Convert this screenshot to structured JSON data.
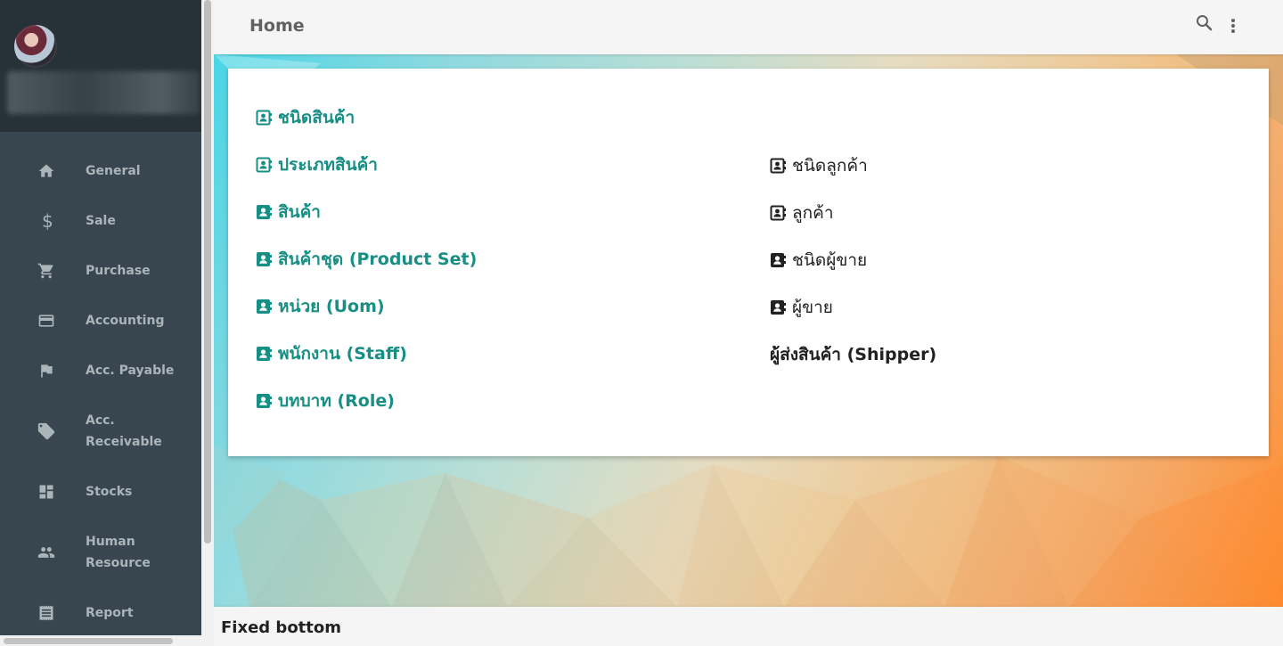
{
  "sidebar": {
    "items": [
      {
        "label": "General",
        "icon": "home-icon"
      },
      {
        "label": "Sale",
        "icon": "dollar-icon"
      },
      {
        "label": "Purchase",
        "icon": "cart-icon"
      },
      {
        "label": "Accounting",
        "icon": "credit-card-icon"
      },
      {
        "label": "Acc. Payable",
        "icon": "flag-icon"
      },
      {
        "label": "Acc.\nReceivable",
        "icon": "tag-icon"
      },
      {
        "label": "Stocks",
        "icon": "dashboard-icon"
      },
      {
        "label": "Human\nResource",
        "icon": "people-icon"
      },
      {
        "label": "Report",
        "icon": "receipt-icon"
      }
    ]
  },
  "header": {
    "title": "Home"
  },
  "main": {
    "left_links": [
      {
        "label": "ชนิดสินค้า",
        "icon": "contact-outline-icon"
      },
      {
        "label": "ประเภทสินค้า",
        "icon": "contact-outline-icon"
      },
      {
        "label": "สินค้า",
        "icon": "contact-filled-icon"
      },
      {
        "label": "สินค้าชุด (Product Set)",
        "icon": "contact-filled-icon"
      },
      {
        "label": "หน่วย (Uom)",
        "icon": "contact-filled-icon"
      },
      {
        "label": "พนักงาน (Staff)",
        "icon": "contact-filled-icon"
      },
      {
        "label": "บทบาท (Role)",
        "icon": "contact-filled-icon"
      }
    ],
    "right_links": [
      {
        "label": "ชนิดลูกค้า",
        "icon": "contact-outline-icon"
      },
      {
        "label": "ลูกค้า",
        "icon": "contact-outline-icon"
      },
      {
        "label": "ชนิดผู้ขาย",
        "icon": "contact-filled-icon"
      },
      {
        "label": "ผู้ขาย",
        "icon": "contact-filled-icon"
      },
      {
        "label": "ผู้ส่งสินค้า (Shipper)",
        "icon": ""
      }
    ]
  },
  "footer": {
    "text": "Fixed bottom"
  },
  "colors": {
    "sidebar_bg": "#38474f",
    "sidebar_header_bg": "#263238",
    "link_teal": "#178f85",
    "topbar_bg": "#f5f5f5"
  }
}
